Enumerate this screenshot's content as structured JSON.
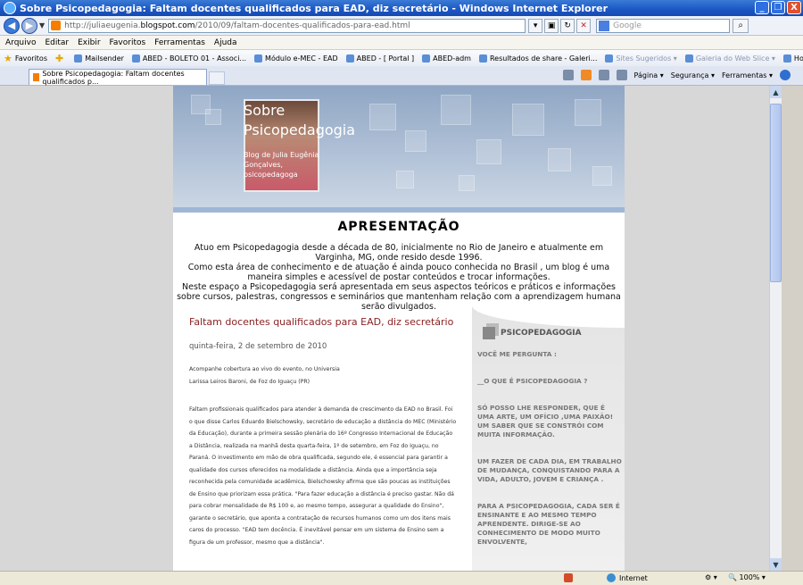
{
  "window": {
    "title": "Sobre Psicopedagogia: Faltam docentes qualificados para EAD, diz secretário - Windows Internet Explorer",
    "minimize": "_",
    "maximize": "❐",
    "close": "X"
  },
  "address": {
    "url_prefix": "http://juliaeugenia.",
    "url_domain": "blogspot.com",
    "url_path": "/2010/09/faltam-docentes-qualificados-para-ead.html",
    "search_placeholder": "Google"
  },
  "menu": [
    "Arquivo",
    "Editar",
    "Exibir",
    "Favoritos",
    "Ferramentas",
    "Ajuda"
  ],
  "favorites": {
    "label": "Favoritos",
    "items": [
      {
        "label": "Mailsender",
        "muted": false
      },
      {
        "label": "ABED - BOLETO 01 - Associ...",
        "muted": false
      },
      {
        "label": "Módulo e-MEC - EAD",
        "muted": false
      },
      {
        "label": "ABED - [ Portal ]",
        "muted": false
      },
      {
        "label": "ABED-adm",
        "muted": false
      },
      {
        "label": "Resultados de share - Galeri...",
        "muted": false
      },
      {
        "label": "Sites Sugeridos ▾",
        "muted": true
      },
      {
        "label": "Galeria do Web Slice ▾",
        "muted": true
      },
      {
        "label": "HotMail gratuito",
        "muted": false
      }
    ]
  },
  "tab": {
    "label": "Sobre Psicopedagogia: Faltam docentes qualificados p..."
  },
  "commands": [
    "Página ▾",
    "Segurança ▾",
    "Ferramentas ▾"
  ],
  "blog": {
    "title_line1": "Sobre",
    "title_line2": "Psicopedagogia",
    "description": "Blog de Julia Eugênia Gonçalves, psicopedagoga",
    "intro_heading": "APRESENTAÇÃO",
    "intro_lines": [
      "Atuo em Psicopedagogia desde a década de 80, inicialmente no Rio de Janeiro e atualmente em Varginha, MG, onde resido desde 1996.",
      "Como esta área de conhecimento e de atuação é ainda pouco conhecida no Brasil , um blog é uma maneira simples e acessível de postar conteúdos e trocar informações.",
      "Neste espaço a Psicopedagogia será apresentada em seus aspectos teóricos e práticos e informações sobre cursos, palestras, congressos e seminários que mantenham relação com a aprendizagem humana serão divulgados."
    ],
    "post_title": "Faltam docentes qualificados para EAD, diz secretário",
    "post_date": "quinta-feira, 2 de setembro de 2010",
    "post_p1": "Acompanhe cobertura ao vivo do evento, no Universia",
    "post_p2": "Larissa Leiros Baroni, de Foz do Iguaçu (PR)",
    "post_body": "Faltam profissionais qualificados para atender à demanda de crescimento da EAD no Brasil. Foi o que disse Carlos Eduardo Bielschowsky, secretário de educação a distância do MEC (Ministério da Educação), durante a primeira sessão plenária do 16º Congresso Internacional de Educação a Distância, realizada na manhã desta quarta-feira, 1º de setembro, em Foz do Iguaçu, no Paraná. O investimento em mão de obra qualificada, segundo ele, é essencial para garantir a qualidade dos cursos oferecidos na modalidade a distância. Ainda que a importância seja reconhecida pela comunidade acadêmica, Bielschowsky afirma que são poucas as instituições de Ensino que priorizam essa prática. \"Para fazer educação a distância é preciso gastar. Não dá para cobrar mensalidade de R$ 100 e, ao mesmo tempo, assegurar a qualidade do Ensino\", garante o secretário, que aponta a contratação de recursos humanos como um dos itens mais caros do processo. \"EAD tem docência. É inevitável pensar em um sistema de Ensino sem a figura de um professor, mesmo que a distância\".",
    "sidebar_heading": "PSICOPEDAGOGIA",
    "sidebar_blocks": [
      "VOCÊ ME PERGUNTA :",
      "__O QUE É PSICOPEDAGOGIA ?",
      "SÓ POSSO LHE RESPONDER, QUE É UMA ARTE, UM OFÍCIO ,UMA PAIXÃO! UM SABER QUE SE CONSTRÓI COM MUITA INFORMAÇÃO.",
      "UM FAZER DE CADA DIA, EM TRABALHO DE MUDANÇA, CONQUISTANDO PARA A VIDA, ADULTO, JOVEM E CRIANÇA .",
      "PARA A PSICOPEDAGOGIA, CADA SER É ENSINANTE E AO MESMO TEMPO APRENDENTE. DIRIGE-SE AO CONHECIMENTO DE MODO MUITO ENVOLVENTE,"
    ]
  },
  "status": {
    "zone": "Internet",
    "zoom": "100%"
  }
}
